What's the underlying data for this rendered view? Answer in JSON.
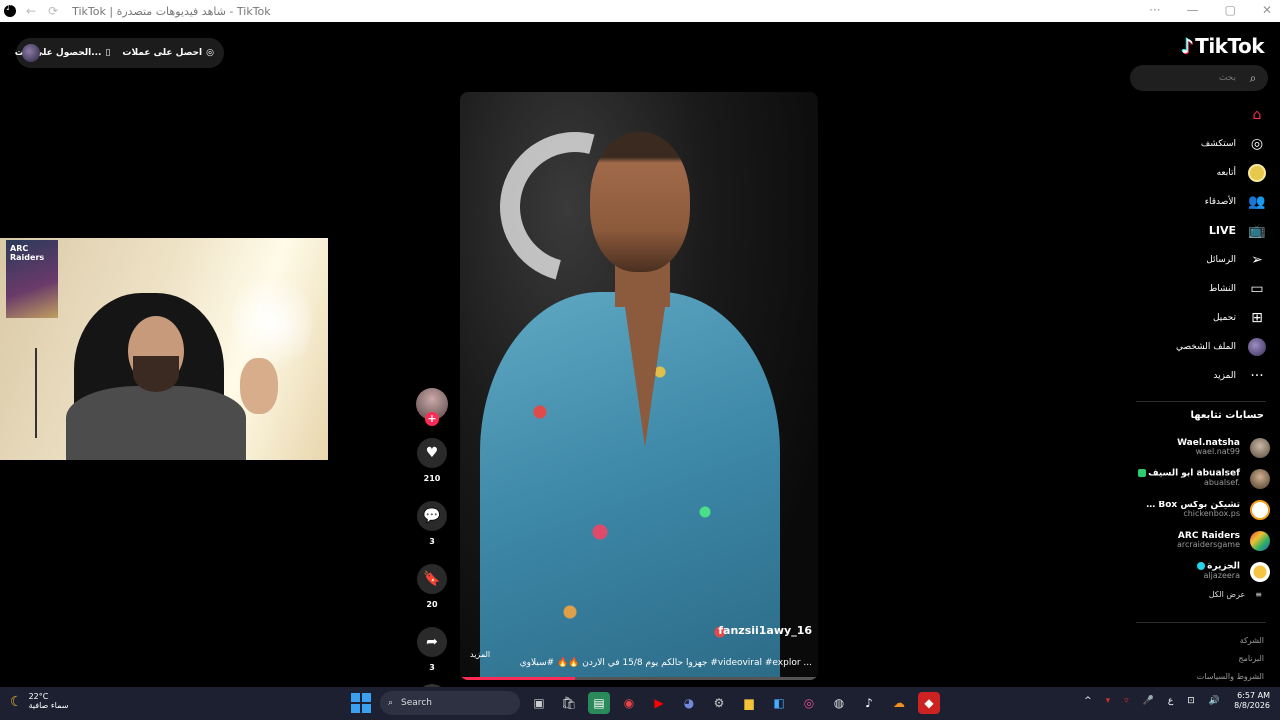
{
  "browser": {
    "title": "TikTok | شاهد فيديوهات متصدرة - TikTok",
    "back_icon": "arrow-left-icon",
    "forward_icon": "arrow-right-icon",
    "reload_icon": "reload-icon"
  },
  "top_pill": {
    "get_coins": "احصل على عملات",
    "get_app": "الحصول على الت..."
  },
  "logo": "TikTok",
  "search": {
    "placeholder": "بحث"
  },
  "nav": {
    "home": "",
    "explore": "استكشف",
    "following": "أتابعه",
    "friends": "الأصدقاء",
    "live": "LIVE",
    "messages": "الرسائل",
    "activity": "النشاط",
    "upload": "تحميل",
    "profile": "الملف الشخصي",
    "more": "المزيد"
  },
  "following_section": {
    "title": "حسابات تتابعها",
    "accounts": [
      {
        "name": "Wael.natsha",
        "username": "wael.nat99"
      },
      {
        "name": "ابو السيف abualsef",
        "username": "abualsef."
      },
      {
        "name": "تشيكن بوكس Chicken Box",
        "username": "chickenbox.ps"
      },
      {
        "name": "ARC Raiders",
        "username": "arcraidersgame"
      },
      {
        "name": "الجزيرة",
        "username": "aljazeera"
      }
    ],
    "see_all": "عرض الكل"
  },
  "footer": {
    "company": "الشركة",
    "program": "البرنامج",
    "terms": "الشروط والسياسات"
  },
  "video": {
    "author": "fanzsii1awy_16",
    "description": "جهزوا حالكم يوم 15/8 في الاردن 🔥🔥 #سبلاوي #videoviral #explor ...",
    "more": "المزيد",
    "progress": 0.32
  },
  "actions": {
    "likes": "210",
    "comments": "3",
    "saves": "20",
    "shares": "3"
  },
  "webcam": {
    "poster_text": "ARC Raiders"
  },
  "taskbar": {
    "temperature": "22°C",
    "weather": "سماء صافية",
    "search": "Search",
    "time": "6:57 AM",
    "date": "8/8/2026",
    "lang": "ع"
  },
  "colors": {
    "accent": "#fe2c55",
    "taskbar": "#1c2030"
  }
}
